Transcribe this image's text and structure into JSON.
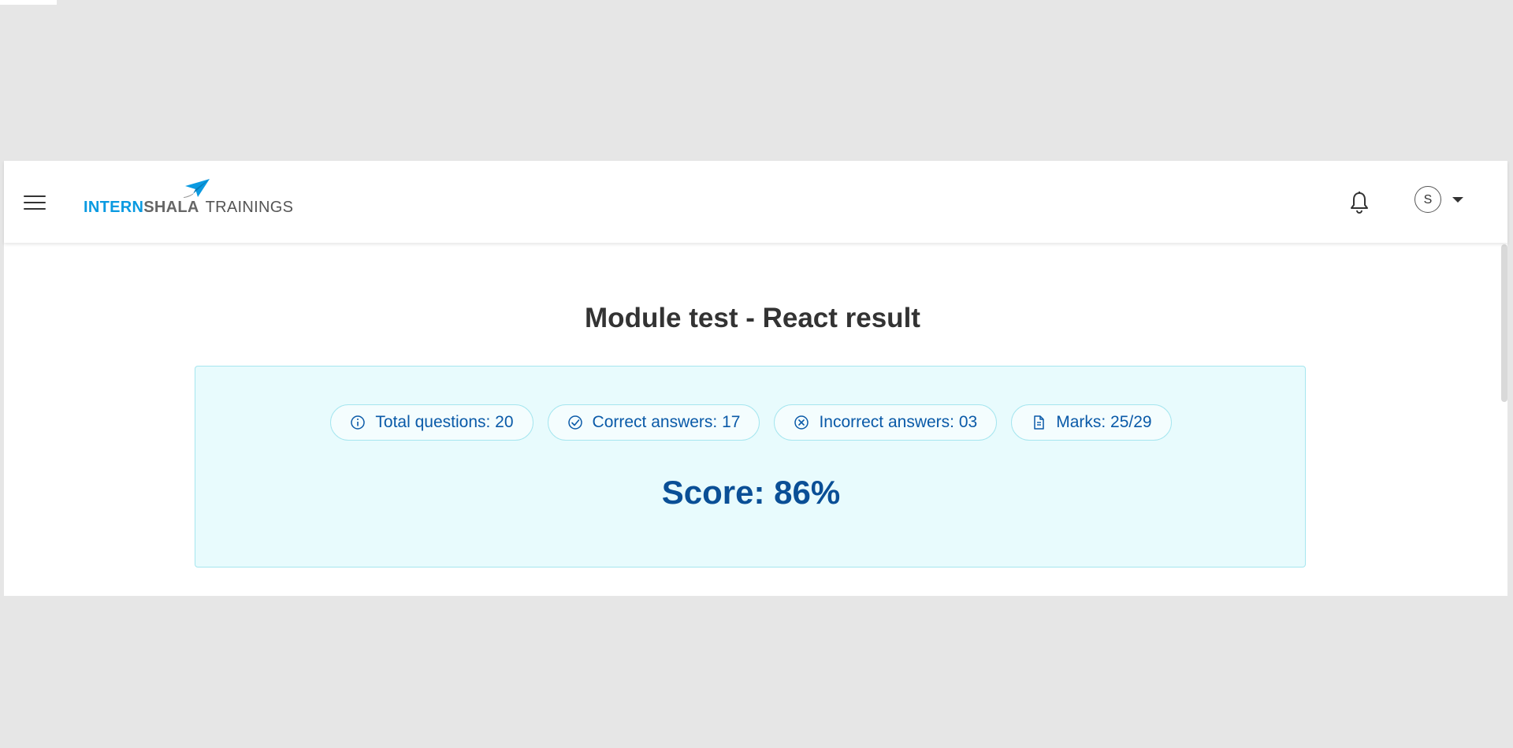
{
  "brand": {
    "part1": "INTERN",
    "part2": "SHALA",
    "part3": "TRAININGS"
  },
  "user": {
    "avatar_initial": "S"
  },
  "result": {
    "title": "Module test - React result",
    "stats": [
      {
        "label": "Total questions: 20",
        "icon": "info-icon"
      },
      {
        "label": "Correct answers: 17",
        "icon": "check-circle-icon"
      },
      {
        "label": "Incorrect answers: 03",
        "icon": "x-circle-icon"
      },
      {
        "label": "Marks: 25/29",
        "icon": "document-icon"
      }
    ],
    "score": "Score: 86%"
  },
  "colors": {
    "brand_blue": "#0a9ae1",
    "card_bg": "#e8fbfd",
    "card_border": "#a6e6ef",
    "score_text": "#0a4f96",
    "pill_text": "#0a5aa8"
  }
}
